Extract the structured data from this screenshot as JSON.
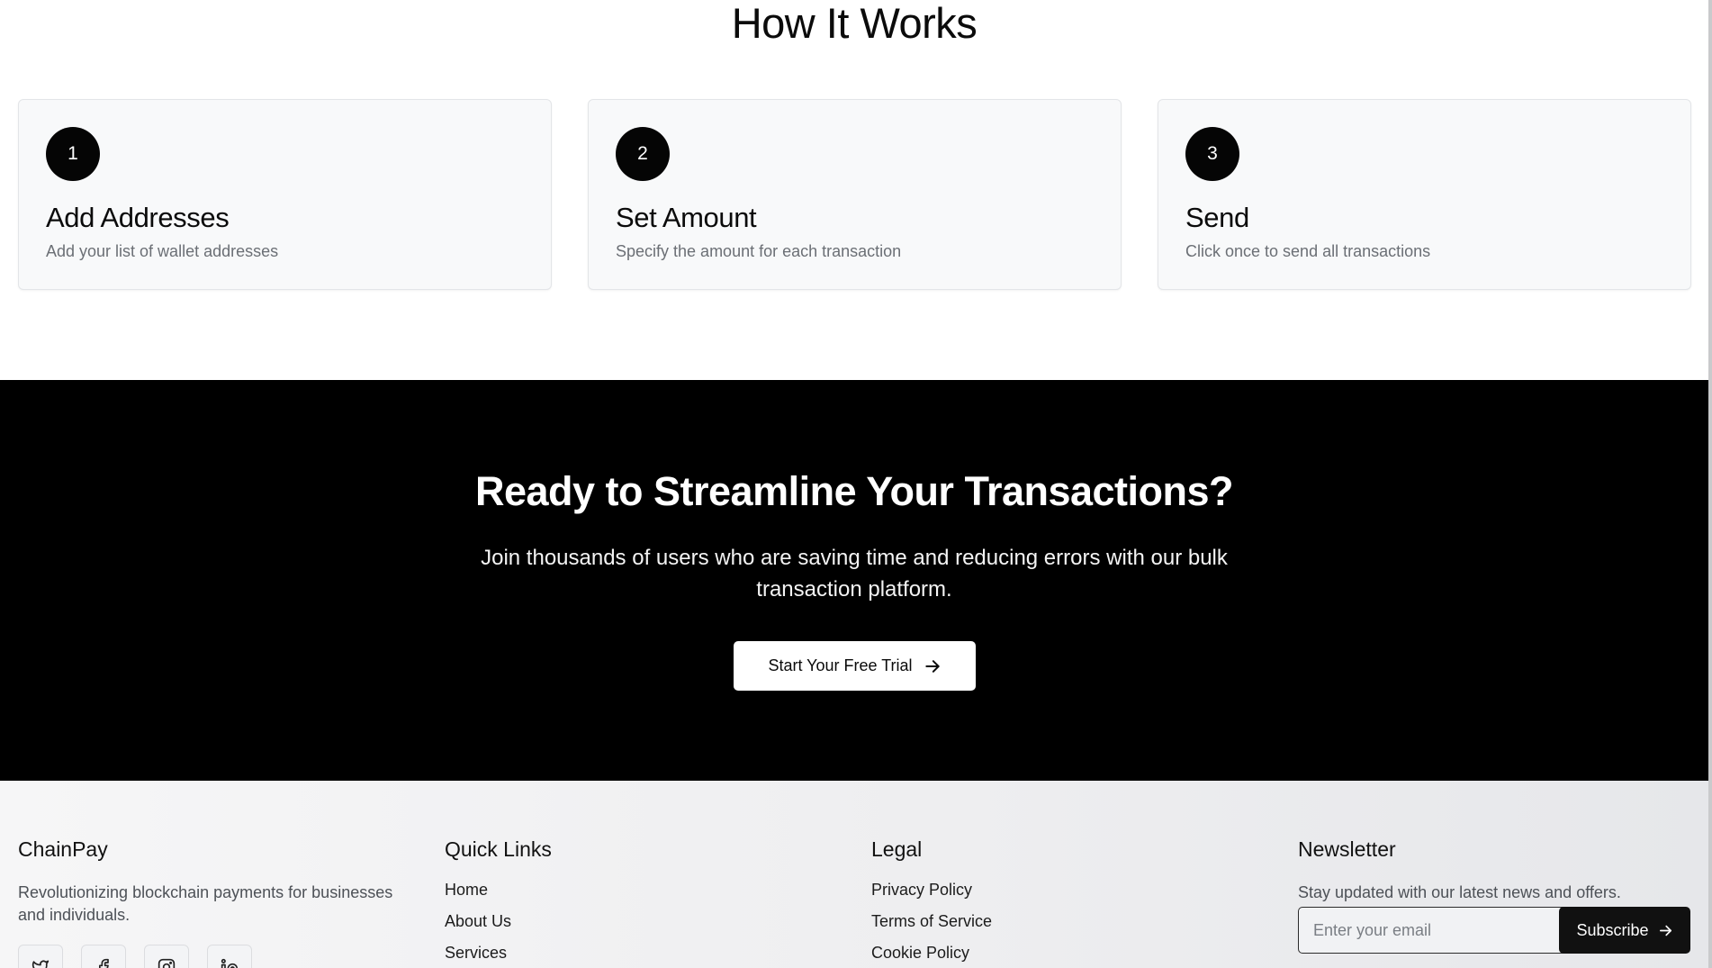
{
  "how_it_works": {
    "title": "How It Works",
    "steps": [
      {
        "number": "1",
        "title": "Add Addresses",
        "description": "Add your list of wallet addresses"
      },
      {
        "number": "2",
        "title": "Set Amount",
        "description": "Specify the amount for each transaction"
      },
      {
        "number": "3",
        "title": "Send",
        "description": "Click once to send all transactions"
      }
    ]
  },
  "cta": {
    "title": "Ready to Streamline Your Transactions?",
    "subtitle": "Join thousands of users who are saving time and reducing errors with our bulk transaction platform.",
    "button_label": "Start Your Free Trial",
    "button_icon": "arrow-right-icon"
  },
  "footer": {
    "brand": {
      "name": "ChainPay",
      "description": "Revolutionizing blockchain payments for businesses and individuals.",
      "social_icons": [
        "twitter-icon",
        "facebook-icon",
        "instagram-icon",
        "linkedin-icon"
      ]
    },
    "quick_links": {
      "heading": "Quick Links",
      "items": [
        "Home",
        "About Us",
        "Services"
      ]
    },
    "legal": {
      "heading": "Legal",
      "items": [
        "Privacy Policy",
        "Terms of Service",
        "Cookie Policy"
      ]
    },
    "newsletter": {
      "heading": "Newsletter",
      "description": "Stay updated with our latest news and offers.",
      "input_placeholder": "Enter your email",
      "button_label": "Subscribe",
      "button_icon": "arrow-right-icon"
    }
  },
  "colors": {
    "cta_background": "#000000",
    "step_badge": "#050505",
    "card_background": "#f8f9fa",
    "footer_background": "#eeeef0"
  }
}
